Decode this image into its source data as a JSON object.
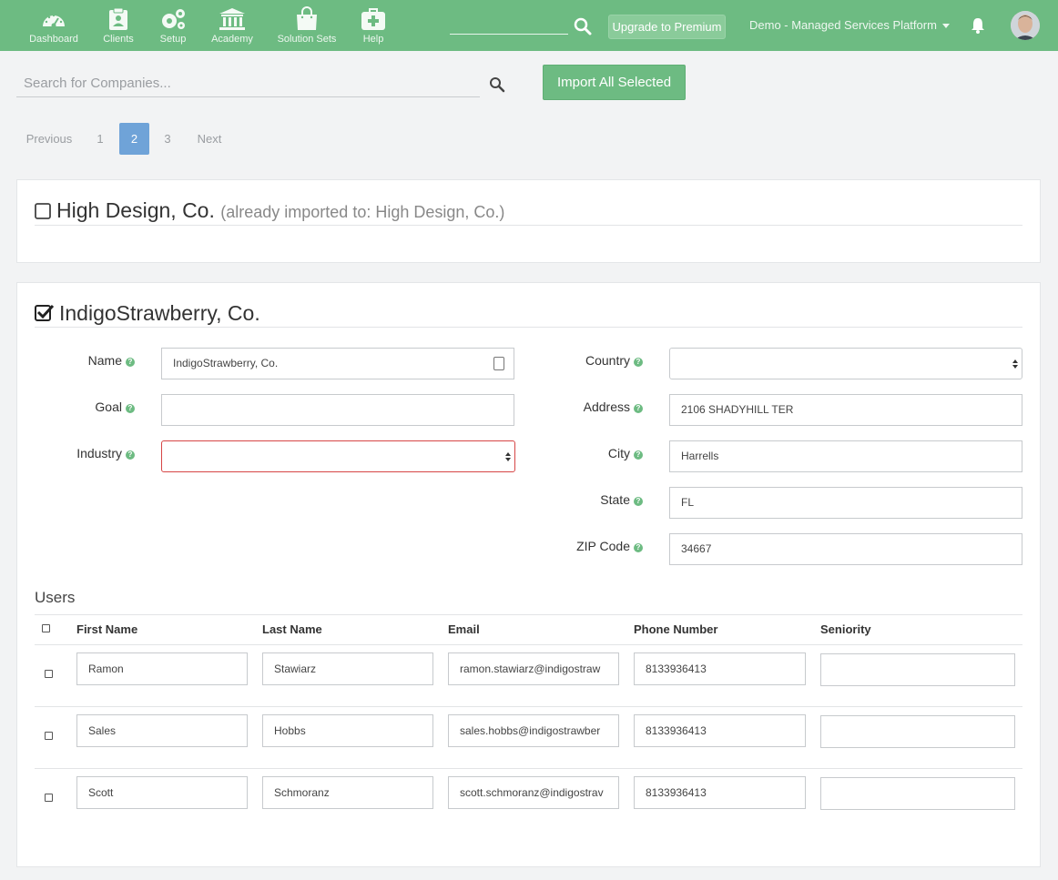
{
  "topnav": {
    "items": [
      {
        "label": "Dashboard",
        "icon": "gauge-icon"
      },
      {
        "label": "Clients",
        "icon": "clipboard-icon"
      },
      {
        "label": "Setup",
        "icon": "gears-icon"
      },
      {
        "label": "Academy",
        "icon": "institution-icon"
      },
      {
        "label": "Solution Sets",
        "icon": "shopping-bag-icon"
      },
      {
        "label": "Help",
        "icon": "medkit-icon"
      }
    ],
    "premium_label": "Upgrade to Premium",
    "account_name": "Demo - Managed Services Platform",
    "colors": {
      "bar": "#6dbb82",
      "accent_blue": "#6fa3d8",
      "error": "#d64545"
    }
  },
  "search": {
    "placeholder": "Search for Companies..."
  },
  "import_label": "Import All Selected",
  "pagination": {
    "previous": "Previous",
    "pages": [
      "1",
      "2",
      "3"
    ],
    "current": "2",
    "next": "Next"
  },
  "companies": [
    {
      "name": "High Design, Co.",
      "note": "(already imported to: High Design, Co.)",
      "checked": false
    },
    {
      "name": "IndigoStrawberry, Co.",
      "checked": true
    }
  ],
  "form": {
    "name": {
      "label": "Name",
      "value": "IndigoStrawberry, Co."
    },
    "goal": {
      "label": "Goal",
      "value": ""
    },
    "industry": {
      "label": "Industry",
      "value": ""
    },
    "country": {
      "label": "Country",
      "value": ""
    },
    "address": {
      "label": "Address",
      "value": "2106 SHADYHILL TER"
    },
    "city": {
      "label": "City",
      "value": "Harrells"
    },
    "state": {
      "label": "State",
      "value": "FL"
    },
    "zip": {
      "label": "ZIP Code",
      "value": "34667"
    }
  },
  "users": {
    "title": "Users",
    "columns": [
      "First Name",
      "Last Name",
      "Email",
      "Phone Number",
      "Seniority"
    ],
    "rows": [
      {
        "first": "Ramon",
        "last": "Stawiarz",
        "email": "ramon.stawiarz@indigostraw",
        "phone": "8133936413",
        "seniority": ""
      },
      {
        "first": "Sales",
        "last": "Hobbs",
        "email": "sales.hobbs@indigostrawber",
        "phone": "8133936413",
        "seniority": ""
      },
      {
        "first": "Scott",
        "last": "Schmoranz",
        "email": "scott.schmoranz@indigostrav",
        "phone": "8133936413",
        "seniority": ""
      }
    ]
  }
}
